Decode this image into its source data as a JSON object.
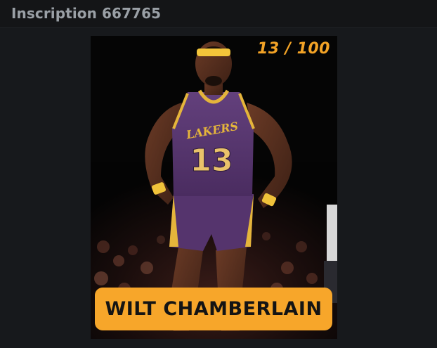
{
  "header": {
    "title": "Inscription 667765"
  },
  "card": {
    "counter": "13 / 100",
    "player_name": "WILT CHAMBERLAIN",
    "jersey_text": "LAKERS",
    "jersey_number": "13",
    "accent_color": "#f7a62a",
    "jersey_color": "#5a3a73"
  }
}
